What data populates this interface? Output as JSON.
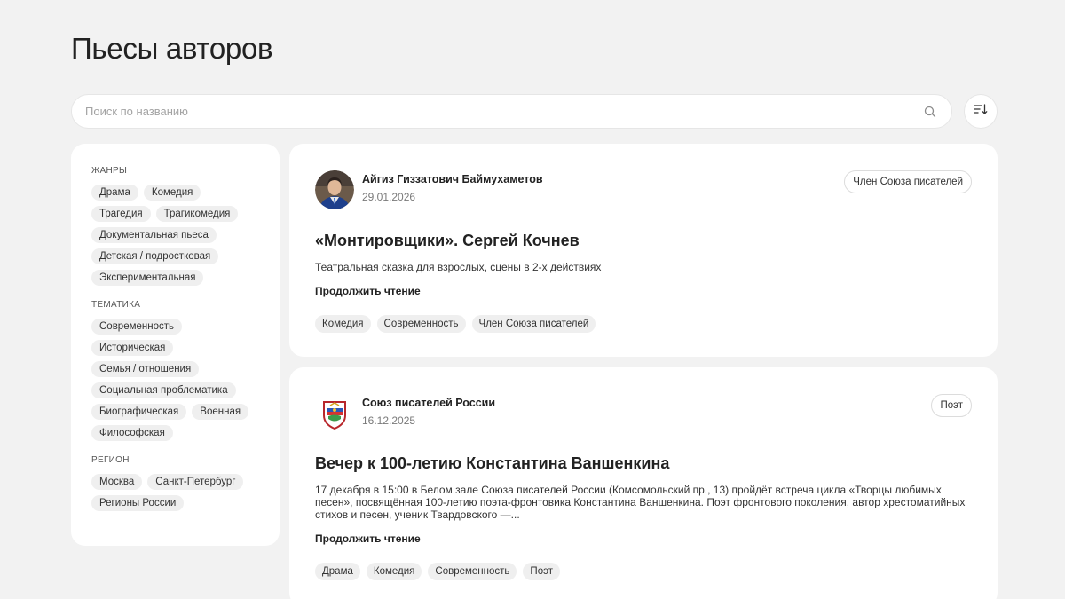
{
  "page": {
    "title": "Пьесы авторов"
  },
  "search": {
    "placeholder": "Поиск по названию"
  },
  "icons": {
    "search": "search-icon",
    "sort": "sort-icon"
  },
  "colors": {
    "background": "#f2f2f2",
    "surface": "#ffffff",
    "chip": "#efefef",
    "text": "#222222",
    "muted": "#7a7a7a"
  },
  "sidebar": {
    "groups": [
      {
        "heading": "Жанры",
        "chips": [
          "Драма",
          "Комедия",
          "Трагедия",
          "Трагикомедия",
          "Документальная пьеса",
          "Детская / подростковая",
          "Экспериментальная"
        ]
      },
      {
        "heading": "Тематика",
        "chips": [
          "Современность",
          "Историческая",
          "Семья / отношения",
          "Социальная проблематика",
          "Биографическая",
          "Военная",
          "Философская"
        ]
      },
      {
        "heading": "Регион",
        "chips": [
          "Москва",
          "Санкт-Петербург",
          "Регионы России"
        ]
      }
    ]
  },
  "posts": [
    {
      "author": "Айгиз Гиззатович Баймухаметов",
      "date": "29.01.2026",
      "badge": "Член Союза писателей",
      "title": "«Монтировщики». Сергей Кочнев",
      "description": "Театральная сказка для взрослых, сцены в 2-х действиях",
      "read_more": "Продолжить чтение",
      "tags": [
        "Комедия",
        "Современность",
        "Член Союза писателей"
      ]
    },
    {
      "author": "Союз писателей России",
      "date": "16.12.2025",
      "badge": "Поэт",
      "title": "Вечер к 100-летию Константина Ваншенкина",
      "description": "17 декабря в 15:00 в Белом зале Союза писателей России (Комсомольский пр., 13) пройдёт встреча цикла «Творцы любимых песен», посвящённая 100-летию поэта-фронтовика Константина Ваншенкина.  Поэт фронтового поколения, автор хрестоматийных стихов и песен, ученик Твардовского —...",
      "read_more": "Продолжить чтение",
      "tags": [
        "Драма",
        "Комедия",
        "Современность",
        "Поэт"
      ]
    }
  ]
}
